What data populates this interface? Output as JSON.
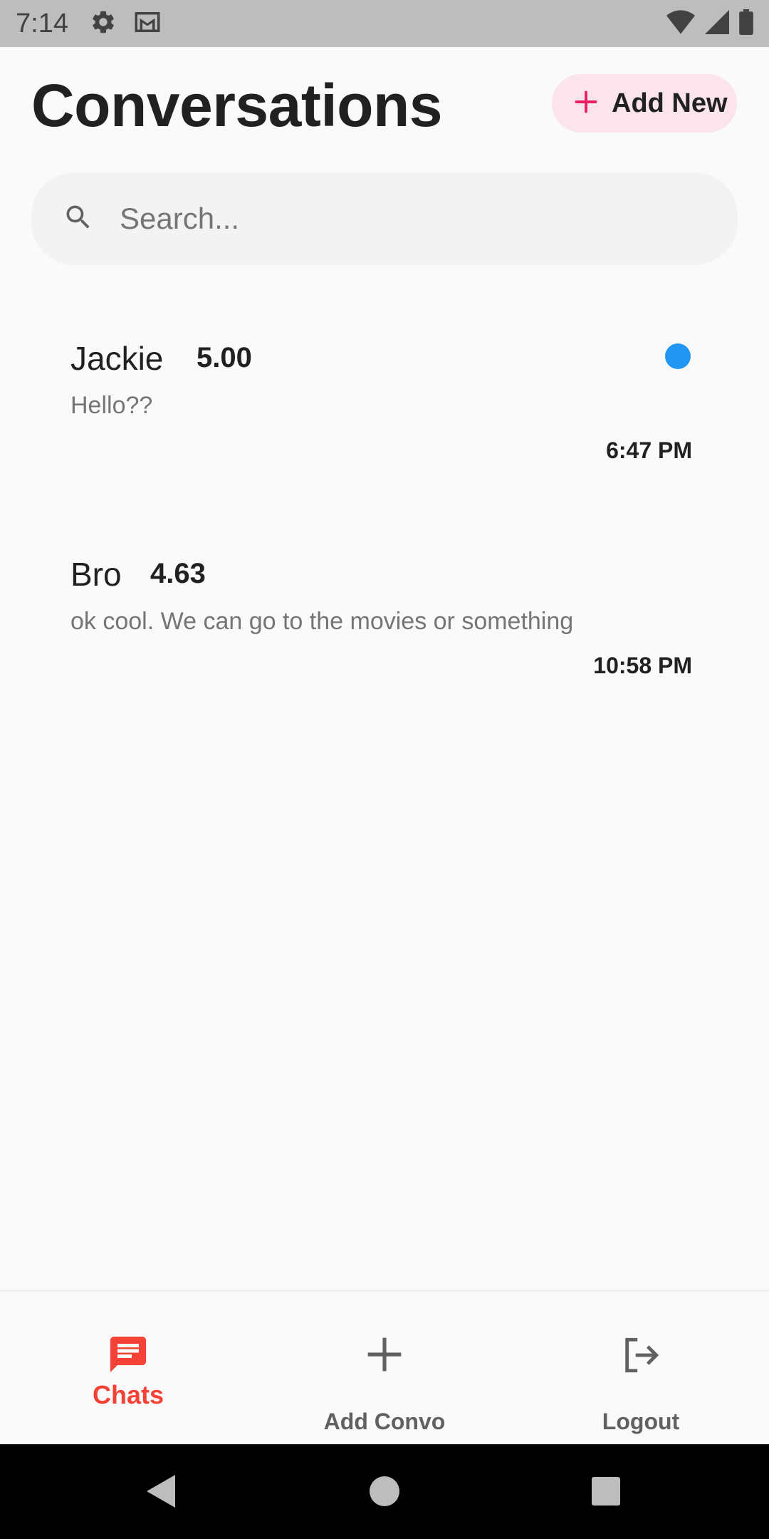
{
  "status_bar": {
    "time": "7:14",
    "icons": [
      "gear-icon",
      "gmail-icon",
      "wifi-icon",
      "cell-signal-icon",
      "battery-icon"
    ]
  },
  "header": {
    "title": "Conversations",
    "add_new_label": "Add New",
    "add_new_icon": "plus-icon"
  },
  "search": {
    "placeholder": "Search...",
    "value": "",
    "icon": "search-icon"
  },
  "conversations": [
    {
      "name": "Jackie",
      "rating": "5.00",
      "preview": "Hello??",
      "time": "6:47 PM",
      "unread": true
    },
    {
      "name": "Bro",
      "rating": "4.63",
      "preview": "ok cool. We can go to the movies or something",
      "time": "10:58 PM",
      "unread": false
    }
  ],
  "bottom_nav": {
    "items": [
      {
        "label": "Chats",
        "icon": "chat-icon",
        "active": true
      },
      {
        "label": "Add Convo",
        "icon": "plus-icon",
        "active": false
      },
      {
        "label": "Logout",
        "icon": "logout-icon",
        "active": false
      }
    ]
  },
  "colors": {
    "accent": "#f44336",
    "add_new_bg": "#fce4ec",
    "add_new_plus": "#e91e63",
    "unread_dot": "#2196f3"
  },
  "system_nav": {
    "buttons": [
      "back-icon",
      "home-icon",
      "recents-icon"
    ]
  }
}
